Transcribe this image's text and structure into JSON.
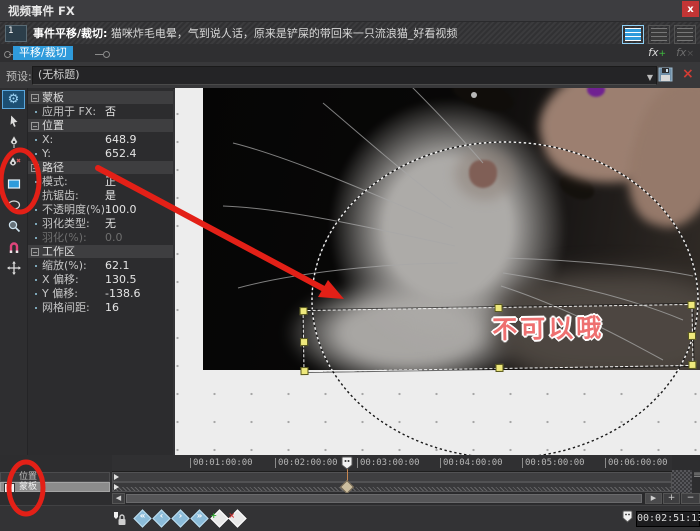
{
  "window": {
    "title": "视频事件 FX"
  },
  "event_bar": {
    "number": "1",
    "prefix": "事件平移/裁切:",
    "name": "猫咪炸毛电晕，气到说人话，原来是铲屎的带回来一只流浪猫_好看视频"
  },
  "fx_chain": {
    "tab_label": "平移/裁切",
    "fx_label": "fx",
    "fx_add_badge": "+",
    "fx_del_badge": "×"
  },
  "preset": {
    "label": "预设:",
    "value": "(无标题)"
  },
  "properties": {
    "groups": [
      {
        "title": "蒙板",
        "rows": [
          {
            "label": "应用于 FX:",
            "value": "否"
          }
        ]
      },
      {
        "title": "位置",
        "rows": [
          {
            "label": "X:",
            "value": "648.9"
          },
          {
            "label": "Y:",
            "value": "652.4"
          }
        ]
      },
      {
        "title": "路径",
        "rows": [
          {
            "label": "模式:",
            "value": "正"
          },
          {
            "label": "抗锯齿:",
            "value": "是"
          },
          {
            "label": "不透明度(%):",
            "value": "100.0"
          },
          {
            "label": "羽化类型:",
            "value": "无"
          },
          {
            "label": "羽化(%):",
            "value": "0.0"
          }
        ]
      },
      {
        "title": "工作区",
        "rows": [
          {
            "label": "缩放(%):",
            "value": "62.1"
          },
          {
            "label": "X 偏移:",
            "value": "130.5"
          },
          {
            "label": "Y 偏移:",
            "value": "-138.6"
          },
          {
            "label": "网格间距:",
            "value": "16"
          }
        ]
      }
    ]
  },
  "preview": {
    "overlay_text": "不可以哦"
  },
  "timeline": {
    "ruler_labels": [
      "00:01:00:00",
      "00:02:00:00",
      "00:03:00:00",
      "00:04:00:00",
      "00:05:00:00",
      "00:06:00:00"
    ],
    "tracks": [
      {
        "label": "位置"
      },
      {
        "label": "蒙板",
        "checked": "✓"
      }
    ],
    "time_display": "00:02:51:13"
  },
  "icons": {
    "close": "x",
    "dropdown_arrow": "▼",
    "preset_remove": "×",
    "scroll_left": "◀",
    "scroll_right": "▶",
    "zoom_in": "+",
    "zoom_out": "−",
    "kf_first": "«",
    "kf_prev": "‹",
    "kf_next": "›",
    "kf_last": "»",
    "grip": "≡"
  },
  "colors": {
    "accent_blue": "#2f9bdb",
    "annotation_red": "#e32017",
    "handle_yellow": "#efe97c",
    "overlay_text_red": "#ee7070",
    "playhead_orange": "#c8864f"
  }
}
